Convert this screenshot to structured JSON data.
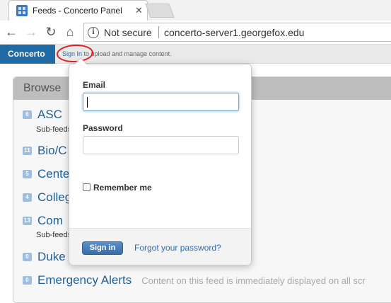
{
  "browser": {
    "tab_title": "Feeds - Concerto Panel",
    "tab_close": "✕",
    "security_label": "Not secure",
    "url": "concerto-server1.georgefox.edu"
  },
  "app": {
    "brand": "Concerto",
    "signin_link": "Sign In",
    "signin_suffix": " to upload and manage content."
  },
  "browse": {
    "title": "Browse",
    "feeds": [
      {
        "count": "6",
        "name": "ASC",
        "subfeeds": "Sub-feeds:"
      },
      {
        "count": "11",
        "name": "Bio/C"
      },
      {
        "count": "5",
        "name": "Cente"
      },
      {
        "count": "4",
        "name": "Colleg"
      },
      {
        "count": "13",
        "name": "Com",
        "subfeeds": "Sub-feeds:"
      },
      {
        "count": "0",
        "name": "Duke"
      },
      {
        "count": "0",
        "name": "Emergency Alerts",
        "description": "Content on this feed is immediately displayed on all scr"
      }
    ]
  },
  "login": {
    "email_label": "Email",
    "email_value": "",
    "password_label": "Password",
    "password_value": "",
    "remember_label": "Remember me",
    "remember_checked": false,
    "signin_button": "Sign in",
    "forgot_link": "Forgot your password?"
  },
  "colors": {
    "brand": "#1f6aa5",
    "link": "#2f6fb0",
    "annotation": "#e02020"
  }
}
